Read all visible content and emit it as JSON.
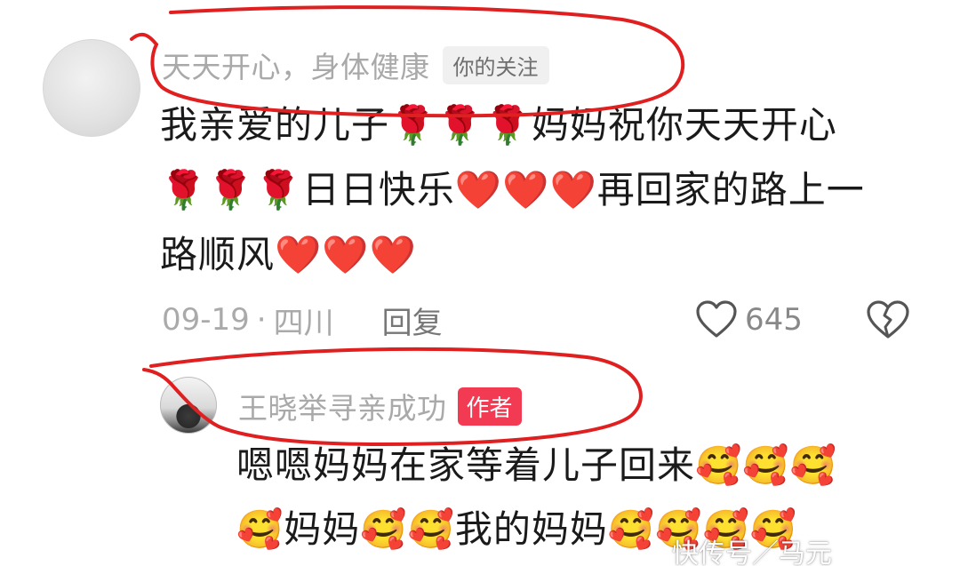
{
  "comment": {
    "username": "天天开心，身体健康",
    "badge": "你的关注",
    "text_lines": [
      "我亲爱的儿子🌹🌹🌹妈妈祝你天天开心",
      "🌹🌹🌹日日快乐❤️❤️❤️再回家的路上一",
      "路顺风❤️❤️❤️"
    ],
    "date": "09-19",
    "separator": "·",
    "location": "四川",
    "reply_label": "回复",
    "like_count": "645",
    "icons": {
      "like": "heart-outline-icon",
      "dislike": "broken-heart-icon"
    }
  },
  "reply": {
    "username": "王晓举寻亲成功",
    "badge": "作者",
    "text_lines": [
      "嗯嗯妈妈在家等着儿子回来🥰🥰🥰",
      "🥰妈妈🥰🥰我的妈妈🥰🥰🥰🥰"
    ]
  },
  "watermark": "快传号／马元",
  "colors": {
    "username": "#a9a9a9",
    "author_badge": "#f23a52",
    "annotation": "#e02020",
    "text": "#1a1a1a"
  }
}
